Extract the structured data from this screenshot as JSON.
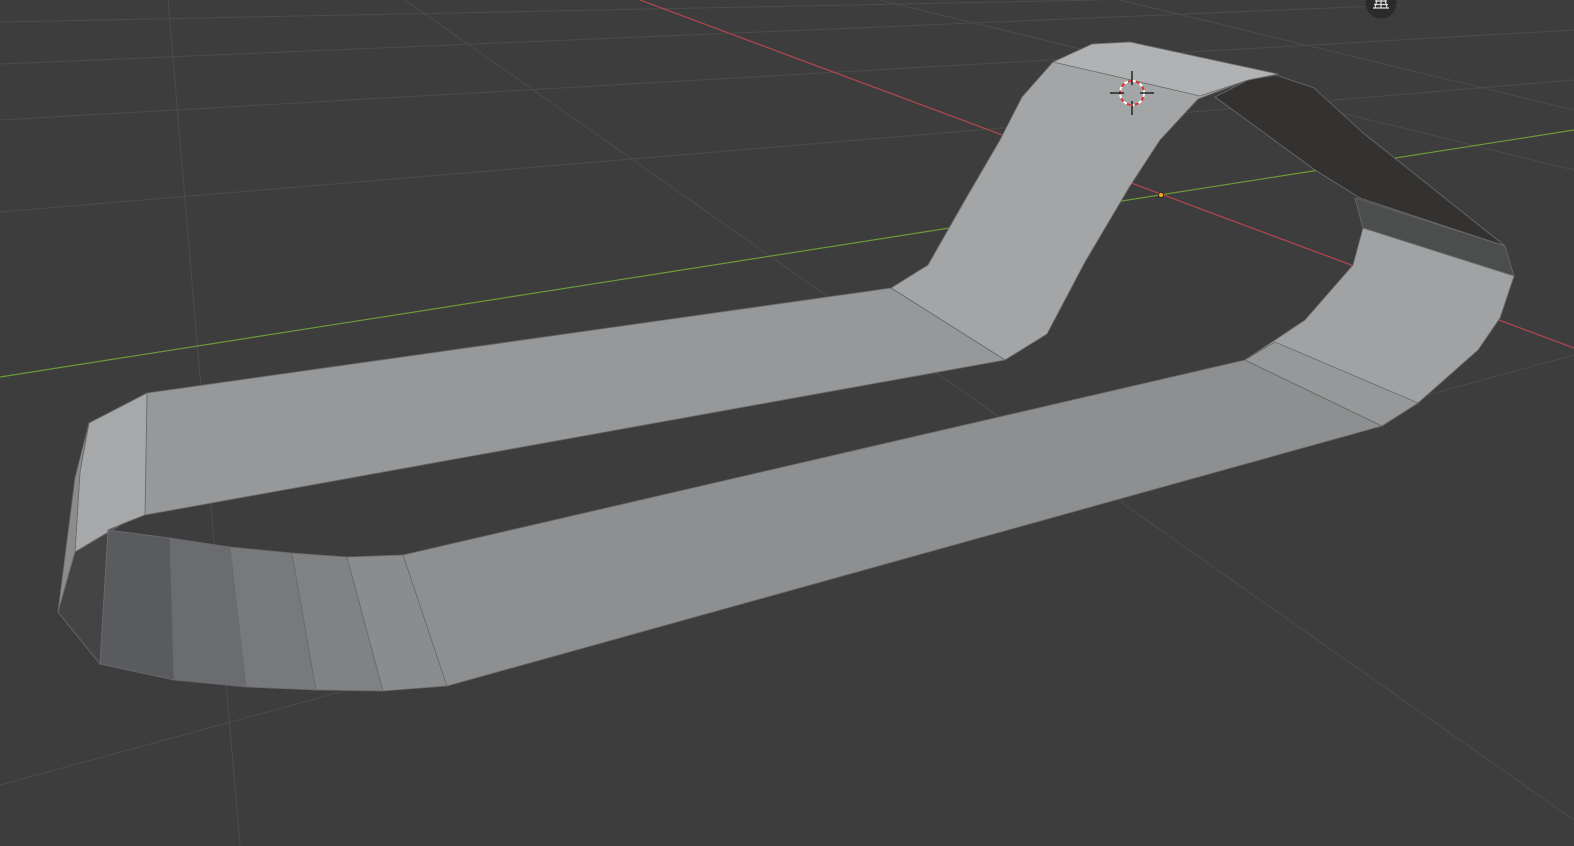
{
  "viewport": {
    "background_color": "#3d3d3d",
    "grid_color": "#4a4a4a",
    "x_axis_color": "#b34650",
    "y_axis_color": "#6c9a3a",
    "mesh_light": "#a3a5a6",
    "mesh_mid": "#8e8f90",
    "mesh_dark": "#333230"
  },
  "gizmos": {
    "cursor_icon": "3d-cursor-icon",
    "origin_icon": "object-origin-dot",
    "overlay_icon": "grid-overlay-icon"
  }
}
